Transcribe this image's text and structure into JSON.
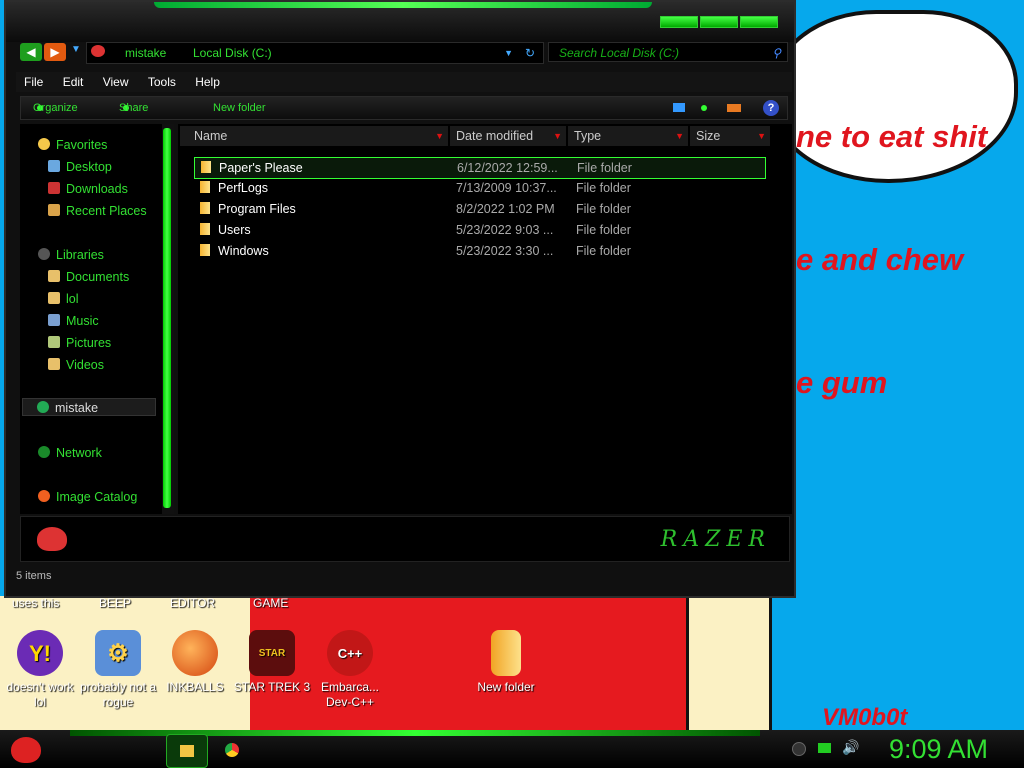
{
  "bubble": {
    "lines": [
      "ne to eat shit",
      "e and chew",
      "e gum"
    ]
  },
  "signature": "VM0b0t",
  "cut_labels": [
    "uses this",
    "BEEP",
    "EDITOR",
    "GAME"
  ],
  "desktop_icons": [
    {
      "label": "doesn't work lol",
      "icon": "yahoo-messenger-icon"
    },
    {
      "label": "probably not a rogue",
      "icon": "gear-program-icon"
    },
    {
      "label": "INKBALLS",
      "icon": "inkball-icon"
    },
    {
      "label": "STAR TREK 3",
      "icon": "star-wars-game-icon"
    },
    {
      "label": "Embarca... Dev-C++",
      "icon": "dev-cpp-icon"
    },
    {
      "label": "New folder",
      "icon": "folder-icon"
    }
  ],
  "window": {
    "address": {
      "location": "mistake",
      "drive": "Local Disk (C:)"
    },
    "search_placeholder": "Search Local Disk (C:)",
    "menu": [
      "File",
      "Edit",
      "View",
      "Tools",
      "Help"
    ],
    "commands": {
      "organize": "Organize",
      "share": "Share with",
      "new_folder": "New folder"
    },
    "nav": {
      "favorites": "Favorites",
      "desktop": "Desktop",
      "downloads": "Downloads",
      "recent": "Recent Places",
      "libraries": "Libraries",
      "documents": "Documents",
      "lol": "lol",
      "music": "Music",
      "pictures": "Pictures",
      "videos": "Videos",
      "user": "mistake",
      "network": "Network",
      "catalog": "Image Catalog"
    },
    "columns": {
      "name": "Name",
      "date": "Date modified",
      "type": "Type",
      "size": "Size"
    },
    "files": [
      {
        "name": "Paper's Please",
        "date": "6/12/2022 12:59...",
        "type": "File folder"
      },
      {
        "name": "PerfLogs",
        "date": "7/13/2009 10:37...",
        "type": "File folder"
      },
      {
        "name": "Program Files",
        "date": "8/2/2022 1:02 PM",
        "type": "File folder"
      },
      {
        "name": "Users",
        "date": "5/23/2022 9:03 ...",
        "type": "File folder"
      },
      {
        "name": "Windows",
        "date": "5/23/2022 3:30 ...",
        "type": "File folder"
      }
    ],
    "brand": "RAZER",
    "status": "5 items"
  },
  "taskbar": {
    "clock": "9:09 AM"
  },
  "colors": {
    "accent": "#33e033",
    "desktop": "#06a8ec",
    "alert": "#e0151e"
  }
}
